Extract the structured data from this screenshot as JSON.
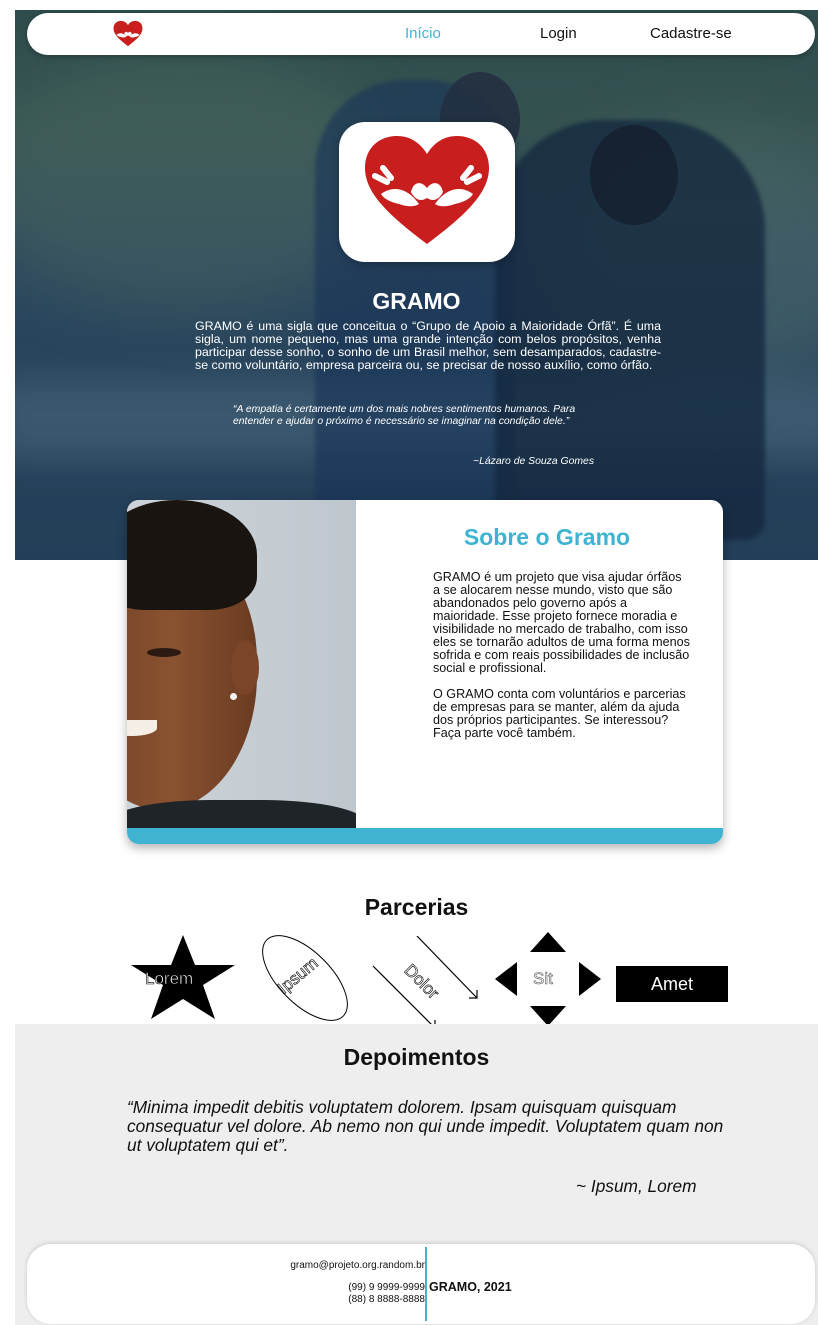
{
  "colors": {
    "accent": "#3fb4d2",
    "brand_red": "#c81e1e"
  },
  "nav": {
    "logo_icon": "heart-hands-icon",
    "items": [
      {
        "label": "Início",
        "active": true
      },
      {
        "label": "Login",
        "active": false
      },
      {
        "label": "Cadastre-se",
        "active": false
      }
    ]
  },
  "hero": {
    "title": "GRAMO",
    "text": "GRAMO é uma sigla que conceitua o “Grupo de Apoio a Maioridade Órfã”. É uma sigla, um nome pequeno, mas uma grande intenção com belos propósitos, venha participar desse sonho, o sonho de um Brasil melhor, sem desamparados, cadastre-se como voluntário, empresa parceira ou, se precisar de nosso auxílio, como órfão.",
    "quote": "“A empatia é certamente um dos mais nobres sentimentos humanos. Para entender e ajudar o próximo é necessário se imaginar na condição dele.”",
    "quote_author": "~Lázaro de Souza Gomes"
  },
  "about": {
    "title": "Sobre o Gramo",
    "paragraph1": "GRAMO é um projeto que visa ajudar órfãos a se alocarem nesse mundo, visto que são abandonados pelo governo após a maioridade. Esse projeto fornece moradia e visibilidade no mercado de trabalho, com isso eles se tornarão adultos de uma forma menos sofrida e com reais possibilidades de inclusão social e profissional.",
    "paragraph2": "O GRAMO conta com voluntários e parcerias de empresas para se manter, além da ajuda dos próprios participantes. Se interessou? Faça parte você também."
  },
  "partners": {
    "title": "Parcerias",
    "items": [
      {
        "label": "Lorem",
        "icon": "star-icon"
      },
      {
        "label": "Ipsum",
        "icon": "ellipse-icon"
      },
      {
        "label": "Dolor",
        "icon": "arrows-icon"
      },
      {
        "label": "Sit",
        "icon": "triangles-icon"
      },
      {
        "label": "Amet",
        "icon": "rectangle-icon"
      }
    ]
  },
  "testimonials": {
    "title": "Depoimentos",
    "quote": "“Minima impedit debitis voluptatem dolorem. Ipsam quisquam quisquam consequatur vel dolore. Ab nemo non qui unde impedit. Voluptatem quam non ut voluptatem qui et”.",
    "author": "~ Ipsum, Lorem"
  },
  "footer": {
    "email": "gramo@projeto.org.random.br",
    "phone1": "(99) 9 9999-9999",
    "phone2": "(88) 8 8888-8888",
    "brand": "GRAMO, 2021"
  }
}
